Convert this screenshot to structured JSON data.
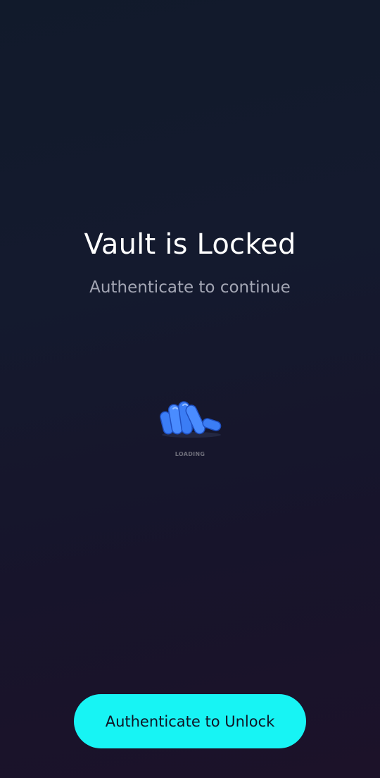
{
  "lock_screen": {
    "title": "Vault is Locked",
    "subtitle": "Authenticate to continue",
    "loading_text": "LOADING",
    "loader_icon": "hand-loader-icon",
    "unlock_button_label": "Authenticate to Unlock"
  },
  "colors": {
    "background_top": "#111a2b",
    "background_bottom": "#1c1229",
    "accent": "#17f4f4",
    "loader_blue": "#3b7df5"
  }
}
